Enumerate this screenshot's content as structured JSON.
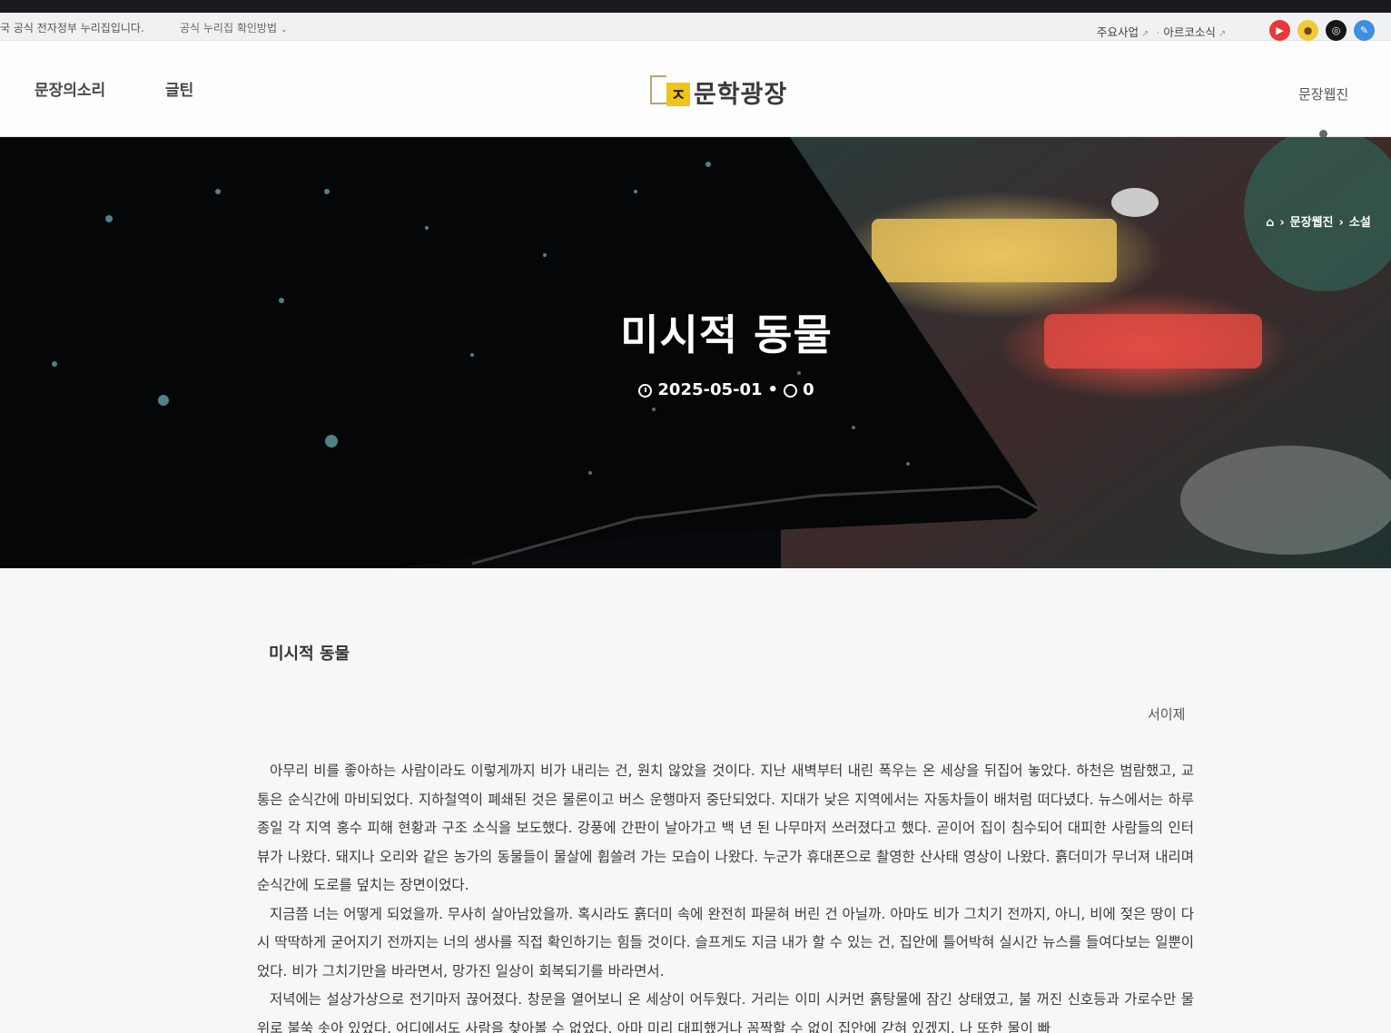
{
  "utility": {
    "gov_notice": "국 공식 전자정부 누리집입니다.",
    "gov_guide": "공식 누리집 확인방법",
    "links": [
      "주요사업",
      "아르코소식"
    ]
  },
  "social": [
    "youtube-icon",
    "kakao-icon",
    "instagram-icon",
    "blog-icon"
  ],
  "header": {
    "nav_left": [
      "문장의소리",
      "글틴"
    ],
    "logo_text": "문학광장",
    "nav_right": "문장웹진"
  },
  "hero": {
    "breadcrumb": [
      "문장웹진",
      "소설"
    ],
    "title": "미시적 동물",
    "date": "2025-05-01",
    "comments": "0"
  },
  "article": {
    "title": "미시적 동물",
    "author": "서이제",
    "paragraphs": [
      "아무리 비를 좋아하는 사람이라도 이렇게까지 비가 내리는 건, 원치 않았을 것이다. 지난 새벽부터 내린 폭우는 온 세상을 뒤집어 놓았다. 하천은 범람했고, 교통은 순식간에 마비되었다. 지하철역이 폐쇄된 것은 물론이고 버스 운행마저 중단되었다. 지대가 낮은 지역에서는 자동차들이 배처럼 떠다녔다. 뉴스에서는 하루 종일 각 지역 홍수 피해 현황과 구조 소식을 보도했다. 강풍에 간판이 날아가고 백 년 된 나무마저 쓰러졌다고 했다. 곧이어 집이 침수되어 대피한 사람들의 인터뷰가 나왔다. 돼지나 오리와 같은 농가의 동물들이 물살에 휩쓸려 가는 모습이 나왔다. 누군가 휴대폰으로 촬영한 산사태 영상이 나왔다. 흙더미가 무너져 내리며 순식간에 도로를 덮치는 장면이었다.",
      "지금쯤 너는 어떻게 되었을까. 무사히 살아남았을까. 혹시라도 흙더미 속에 완전히 파묻혀 버린 건 아닐까. 아마도 비가 그치기 전까지, 아니, 비에 젖은 땅이 다시 딱딱하게 굳어지기 전까지는 너의 생사를 직접 확인하기는 힘들 것이다. 슬프게도 지금 내가 할 수 있는 건, 집안에 틀어박혀 실시간 뉴스를 들여다보는 일뿐이었다. 비가 그치기만을 바라면서, 망가진 일상이 회복되기를 바라면서.",
      "저녁에는 설상가상으로 전기마저 끊어졌다. 창문을 열어보니 온 세상이 어두웠다. 거리는 이미 시커먼 흙탕물에 잠긴 상태였고, 불 꺼진 신호등과 가로수만 물 위로 불쑥 솟아 있었다. 어디에서도 사람을 찾아볼 수 없었다. 아마 미리 대피했거나 꼼짝할 수 없이 집안에 갇혀 있겠지. 나 또한 물이 빠"
    ]
  }
}
